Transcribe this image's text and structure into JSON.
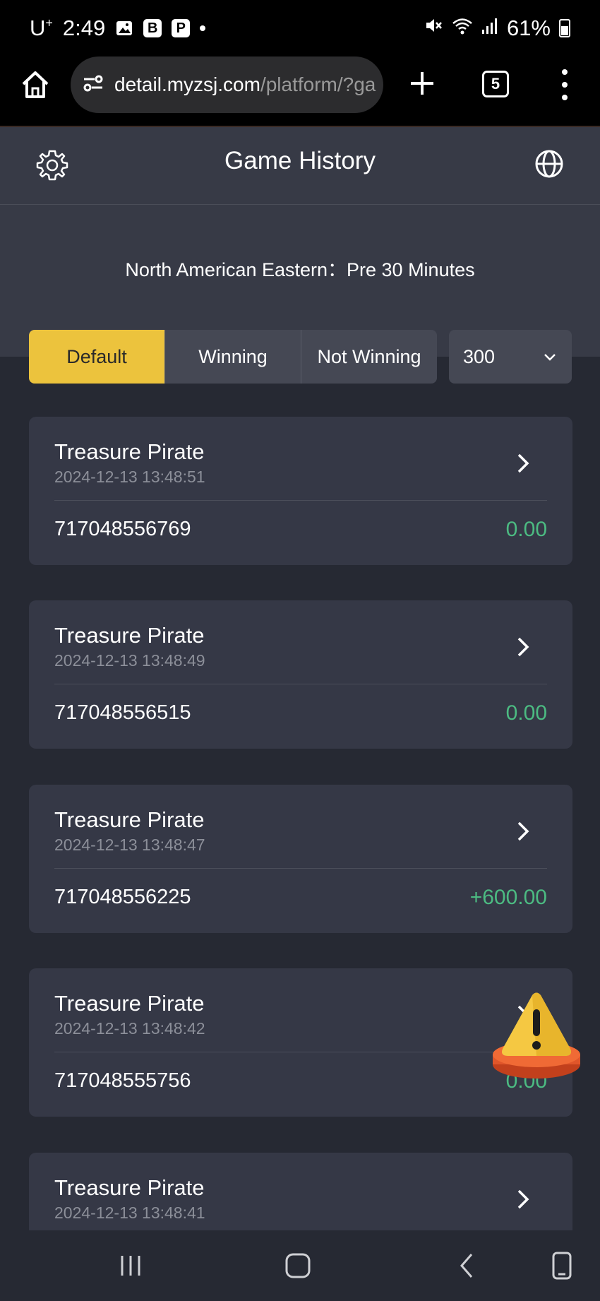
{
  "status_bar": {
    "carrier": "U",
    "carrier_sup": "+",
    "time": "2:49",
    "battery": "61%"
  },
  "browser": {
    "url_domain": "detail.myzsj.com",
    "url_path": "/platform/?ga",
    "tab_count": "5"
  },
  "header": {
    "title": "Game History"
  },
  "timezone_text": "North American Eastern：Pre 30 Minutes",
  "filters": {
    "tabs": [
      "Default",
      "Winning",
      "Not Winning"
    ],
    "active": "Default",
    "count_selected": "300"
  },
  "records": [
    {
      "game": "Treasure Pirate",
      "time": "2024-12-13 13:48:51",
      "id": "717048556769",
      "amount": "0.00"
    },
    {
      "game": "Treasure Pirate",
      "time": "2024-12-13 13:48:49",
      "id": "717048556515",
      "amount": "0.00"
    },
    {
      "game": "Treasure Pirate",
      "time": "2024-12-13 13:48:47",
      "id": "717048556225",
      "amount": "+600.00"
    },
    {
      "game": "Treasure Pirate",
      "time": "2024-12-13 13:48:42",
      "id": "717048555756",
      "amount": "0.00"
    },
    {
      "game": "Treasure Pirate",
      "time": "2024-12-13 13:48:41",
      "id": "",
      "amount": ""
    }
  ],
  "colors": {
    "accent": "#ecc33d",
    "win_green": "#4cbb82",
    "card_bg": "#353846",
    "page_bg": "#262933"
  }
}
